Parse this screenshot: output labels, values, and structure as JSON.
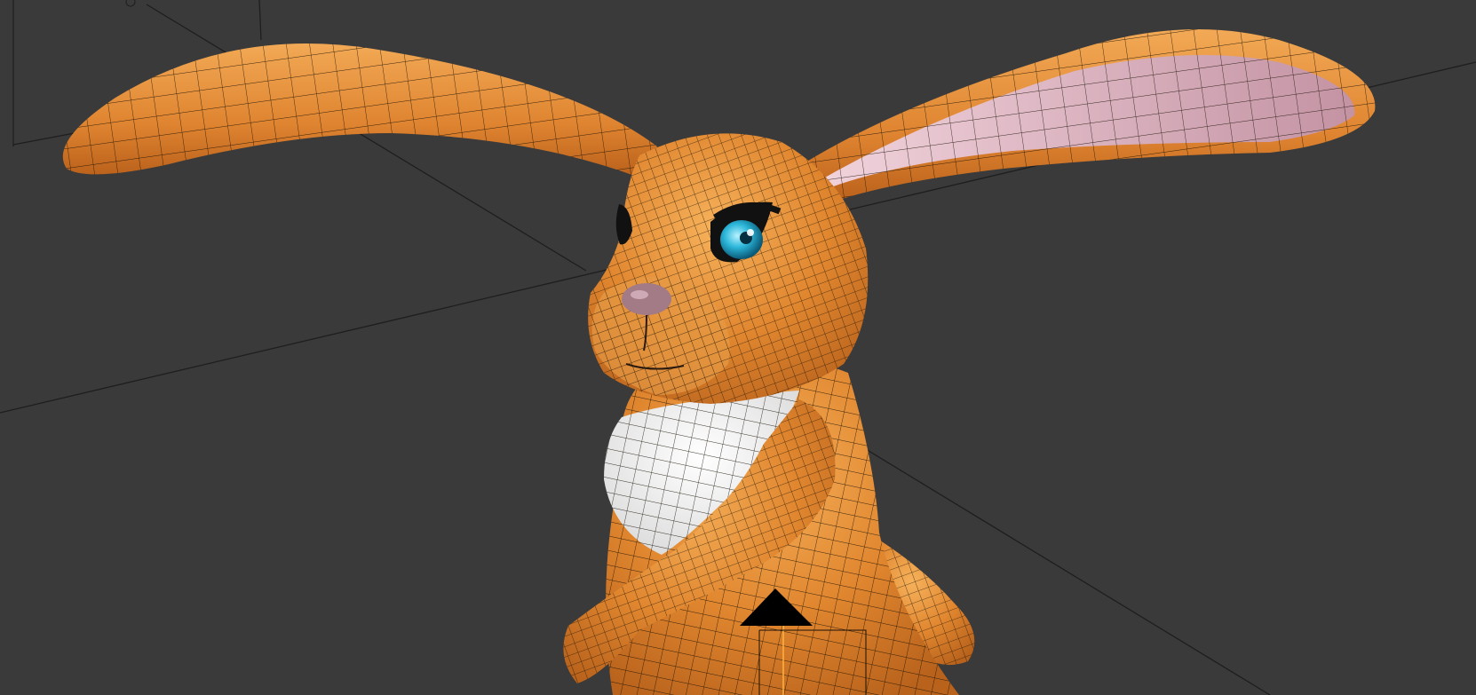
{
  "viewport": {
    "mode": "3d-viewport",
    "background_color": "#3a3a3a",
    "grid_line_color": "#1e1e1e",
    "subject": "rabbit-character-mesh",
    "shading": "solid-with-wireframe-overlay"
  },
  "colors": {
    "fur": "#e0862f",
    "fur_light": "#f0a550",
    "fur_dark": "#b8621c",
    "chest": "#eeeeee",
    "inner_ear": "#d6aab6",
    "eye_iris": "#29b6d8",
    "eye_lid": "#111111",
    "nose": "#a27b86",
    "wire": "#1a1005",
    "camera_marker": "#000000",
    "active_edge": "#ffb33a"
  },
  "icons": {
    "origin": "origin-icon",
    "camera_up_marker": "camera-up-triangle-icon"
  }
}
